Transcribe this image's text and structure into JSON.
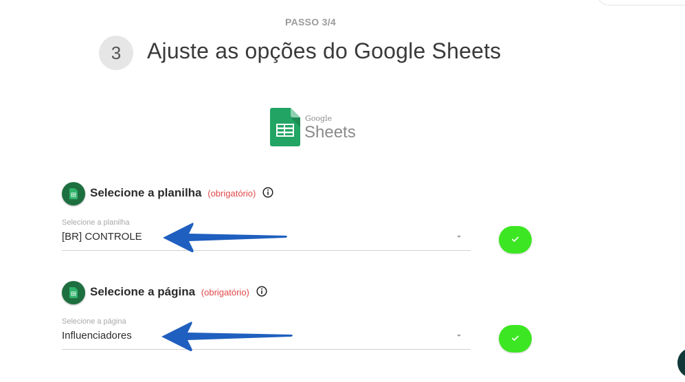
{
  "step": {
    "label": "PASSO 3/4",
    "number": "3",
    "title": "Ajuste as opções do Google Sheets"
  },
  "logo": {
    "google": "Google",
    "sheets": "Sheets",
    "icon": "google-sheets-icon"
  },
  "sections": [
    {
      "title": "Selecione a planilha",
      "required": "(obrigatório)",
      "field_label": "Selecione a planilha",
      "value": "[BR] CONTROLE"
    },
    {
      "title": "Selecione a página",
      "required": "(obrigatório)",
      "field_label": "Selecione a página",
      "value": "Influenciadores"
    }
  ],
  "colors": {
    "sheets_green": "#1e6f3f",
    "check_green": "#3de622",
    "required_red": "#e04848",
    "arrow_blue": "#1f5fbf"
  }
}
